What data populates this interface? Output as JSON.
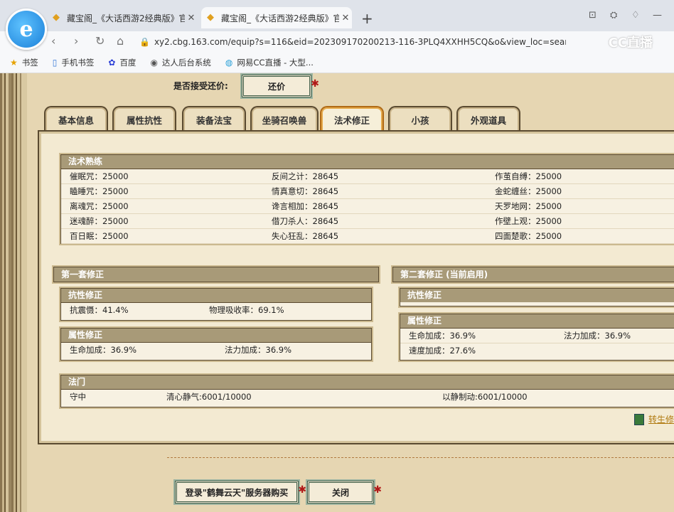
{
  "browser": {
    "logo": "e",
    "tabs": [
      {
        "title": "藏宝阁_《大话西游2经典版》官方",
        "state": "inactive"
      },
      {
        "title": "藏宝阁_《大话西游2经典版》官方",
        "state": "active"
      }
    ],
    "url": "xy2.cbg.163.com/equip?s=116&eid=202309170200213-116-3PLQ4XXHH5CQ&o&view_loc=search_cond|%...",
    "watermark": "CC直播",
    "bookmarks": [
      "书签",
      "手机书签",
      "百度",
      "达人后台系统",
      "网易CC直播 - 大型..."
    ]
  },
  "page": {
    "counter_offer_label": "是否接受还价:",
    "counter_offer_button": "还价",
    "tabs": [
      "基本信息",
      "属性抗性",
      "装备法宝",
      "坐骑召唤兽",
      "法术修正",
      "小孩",
      "外观道具"
    ],
    "selected_tab": "法术修正",
    "spell_mastery": {
      "title": "法术熟练",
      "rows": [
        [
          "催眠咒：25000",
          "反间之计：28645",
          "作茧自缚：25000"
        ],
        [
          "瞌睡咒：25000",
          "情真意切：28645",
          "金蛇缠丝：25000"
        ],
        [
          "离魂咒：25000",
          "谗言相加：28645",
          "天罗地网：25000"
        ],
        [
          "迷魂醉：25000",
          "借刀杀人：28645",
          "作壁上观：25000"
        ],
        [
          "百日眠：25000",
          "失心狂乱：28645",
          "四面楚歌：25000"
        ]
      ]
    },
    "set1": {
      "title": "第一套修正",
      "resist_title": "抗性修正",
      "resist_values": [
        "抗震慑：41.4%",
        "物理吸收率：69.1%"
      ],
      "attr_title": "属性修正",
      "attr_values": [
        "生命加成：36.9%",
        "法力加成：36.9%"
      ]
    },
    "set2": {
      "title": "第二套修正 (当前启用)",
      "resist_title": "抗性修正",
      "attr_title": "属性修正",
      "attr_row1": [
        "生命加成：36.9%",
        "法力加成：36.9%"
      ],
      "attr_row2": [
        "速度加成：27.6%"
      ]
    },
    "fa_men": {
      "title": "法门",
      "values": [
        "守中",
        "清心静气:6001/10000",
        "以静制动:6001/10000"
      ]
    },
    "calc_link": "转生修",
    "login_button": "登录\"鹤舞云天\"服务器购买",
    "close_button": "关闭"
  }
}
